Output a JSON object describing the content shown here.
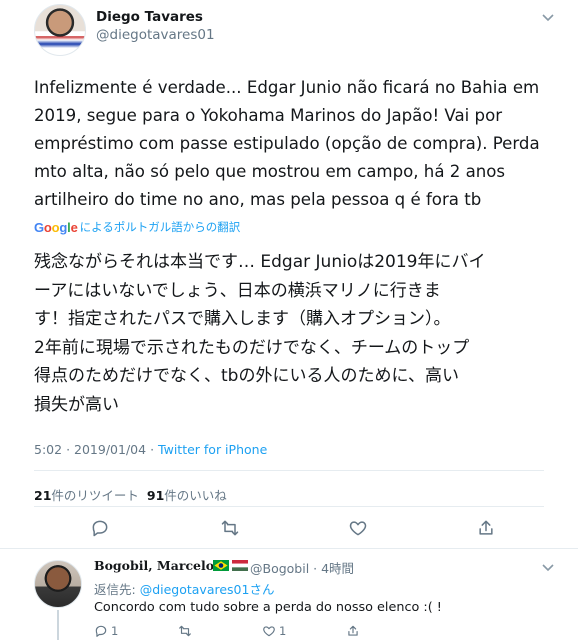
{
  "tweet": {
    "display_name": "Diego Tavares",
    "handle": "@diegotavares01",
    "text_lines": [
      "Infelizmente é verdade... Edgar Junio não ficará no Bahia em",
      "2019, segue para o Yokohama Marinos do Japão! Vai por",
      "empréstimo com passe estipulado (opção de compra). Perda",
      "mto alta, não só pelo que mostrou em campo, há 2 anos",
      "artilheiro do time no ano, mas pela pessoa q é fora tb"
    ],
    "translate_label": "によるポルトガル語からの翻訳",
    "google_letters": [
      "G",
      "o",
      "o",
      "g",
      "l",
      "e"
    ],
    "translated_lines": [
      "残念ながらそれは本当です… Edgar Junioは2019年にバイ",
      "ーアにはいないでしょう、日本の横浜マリノに行きま",
      "す！指定されたパスで購入します（購入オプション）。",
      "2年前に現場で示されたものだけでなく、チームのトップ",
      "得点のためだけでなく、tbの外にいる人のために、高い",
      "損失が高い"
    ],
    "time": "5:02",
    "date": "2019/01/04",
    "separator": "·",
    "source": "Twitter for iPhone",
    "retweet_count": "21",
    "retweet_label": "件のリツイート",
    "like_count": "91",
    "like_label": "件のいいね"
  },
  "reply": {
    "display_name": "𝐁𝐨𝐠𝐨𝐛𝐢𝐥, 𝐌𝐚𝐫𝐜𝐞𝐥𝐨",
    "handle_time": "@Bogobil · 4時間",
    "reply_to_prefix": "返信先: ",
    "reply_to_handle": "@diegotavares01さん",
    "text": "Concordo com tudo sobre a perda do nosso elenco :(  !",
    "reply_count": "1",
    "like_count": "1"
  },
  "colors": {
    "link": "#1da1f2",
    "muted": "#657786",
    "text": "#14171a",
    "google_blue": "#4285f4",
    "google_red": "#ea4335",
    "google_yellow": "#fbbc05",
    "google_green": "#34a853"
  },
  "icons": [
    "caret-down-icon",
    "reply-icon",
    "retweet-icon",
    "like-icon",
    "share-icon",
    "brazil-flag-icon",
    "hungary-flag-icon"
  ]
}
